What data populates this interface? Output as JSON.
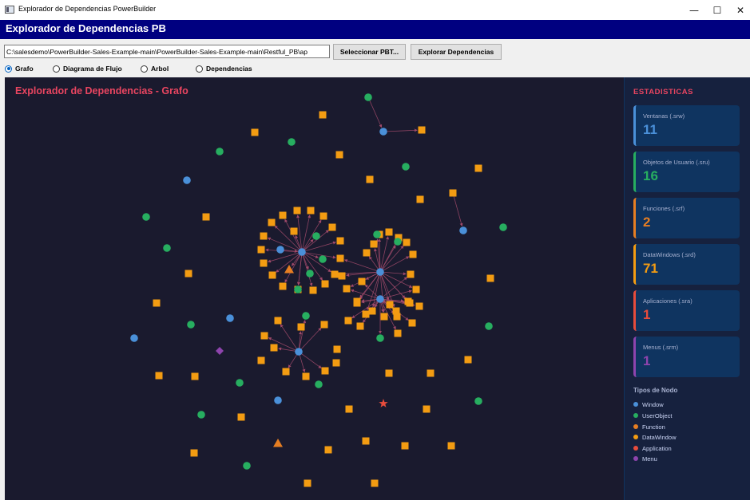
{
  "window": {
    "title": "Explorador de Dependencias PowerBuilder",
    "minimize_glyph": "—",
    "maximize_glyph": "☐",
    "close_glyph": "✕"
  },
  "header": {
    "title": "Explorador de Dependencias PB"
  },
  "toolbar": {
    "path_value": "C:\\salesdemo\\PowerBuilder-Sales-Example-main\\PowerBuilder-Sales-Example-main\\Restful_PB\\ap",
    "select_label": "Seleccionar PBT...",
    "explore_label": "Explorar Dependencias"
  },
  "views": [
    {
      "label": "Grafo",
      "selected": true
    },
    {
      "label": "Diagrama de Flujo",
      "selected": false
    },
    {
      "label": "Arbol",
      "selected": false
    },
    {
      "label": "Dependencias",
      "selected": false
    }
  ],
  "graph": {
    "title": "Explorador de Dependencias - Grafo",
    "background": "#1a1a2e",
    "edge_color": "#a04a6a"
  },
  "stats": {
    "title": "ESTADISTICAS",
    "cards": [
      {
        "label": "Ventanas (.srw)",
        "value": "11",
        "color": "#4a90d9"
      },
      {
        "label": "Objetos de Usuario (.sru)",
        "value": "16",
        "color": "#27ae60"
      },
      {
        "label": "Funciones (.srf)",
        "value": "2",
        "color": "#e67e22"
      },
      {
        "label": "DataWindows (.srd)",
        "value": "71",
        "color": "#f39c12"
      },
      {
        "label": "Aplicaciones (.sra)",
        "value": "1",
        "color": "#e74c3c"
      },
      {
        "label": "Menus (.srm)",
        "value": "1",
        "color": "#8e44ad"
      }
    ]
  },
  "legend": {
    "title": "Tipos de Nodo",
    "items": [
      {
        "label": "Window",
        "color": "#4a90d9"
      },
      {
        "label": "UserObject",
        "color": "#27ae60"
      },
      {
        "label": "Function",
        "color": "#e67e22"
      },
      {
        "label": "DataWindow",
        "color": "#f39c12"
      },
      {
        "label": "Application",
        "color": "#e74c3c"
      },
      {
        "label": "Menu",
        "color": "#8e44ad"
      }
    ]
  }
}
